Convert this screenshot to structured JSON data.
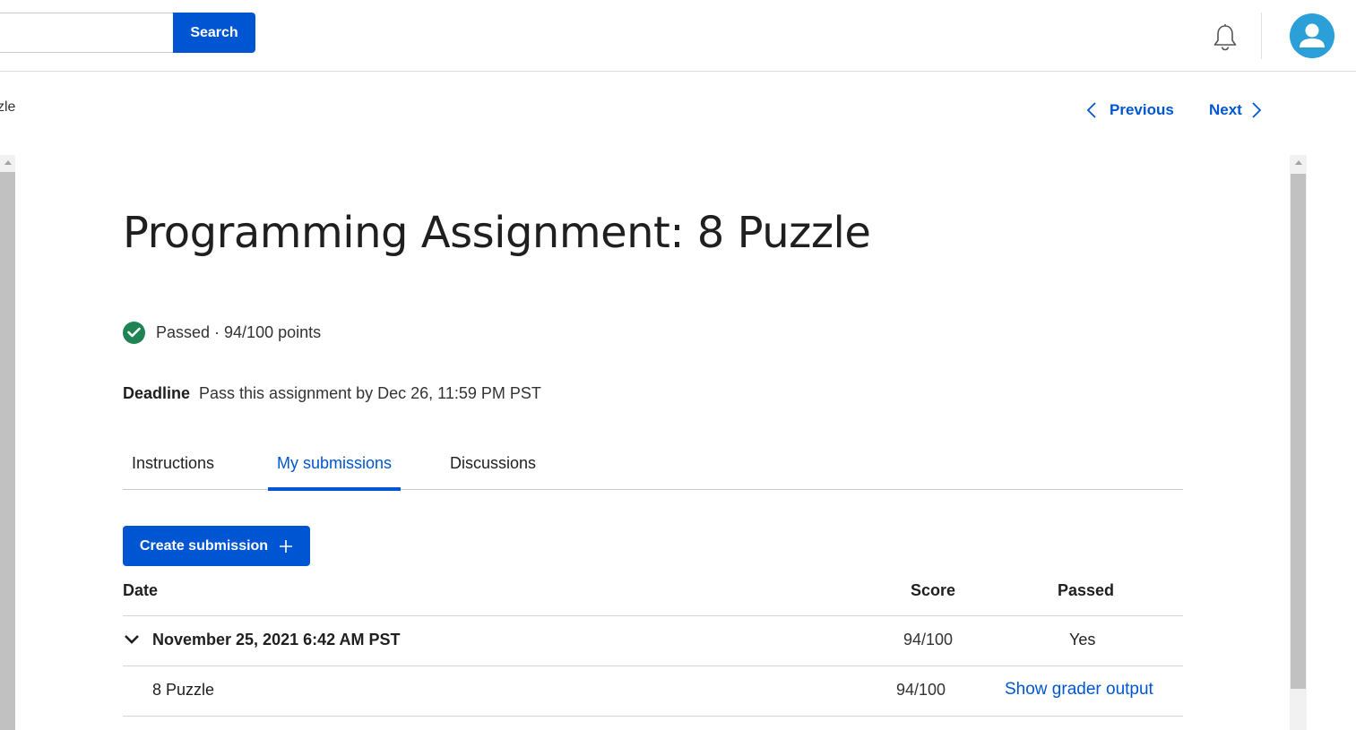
{
  "header": {
    "search_placeholder": "",
    "search_button": "Search"
  },
  "breadcrumb": {
    "fragment": "zle"
  },
  "nav": {
    "previous": "Previous",
    "next": "Next"
  },
  "assignment": {
    "title": "Programming Assignment: 8 Puzzle",
    "status": "Passed · 94/100 points",
    "deadline_label": "Deadline",
    "deadline_text": "Pass this assignment by Dec 26, 11:59 PM PST"
  },
  "tabs": [
    {
      "label": "Instructions",
      "active": false
    },
    {
      "label": "My submissions",
      "active": true
    },
    {
      "label": "Discussions",
      "active": false
    }
  ],
  "create_submission": "Create submission",
  "table": {
    "headers": {
      "date": "Date",
      "score": "Score",
      "passed": "Passed"
    },
    "rows": [
      {
        "date": "November 25, 2021 6:42 AM PST",
        "score": "94/100",
        "passed": "Yes"
      },
      {
        "part": "8 Puzzle",
        "score": "94/100",
        "action": "Show grader output"
      }
    ]
  },
  "colors": {
    "accent": "#0056d2",
    "success": "#1f8354",
    "avatar": "#2a9fd8"
  }
}
